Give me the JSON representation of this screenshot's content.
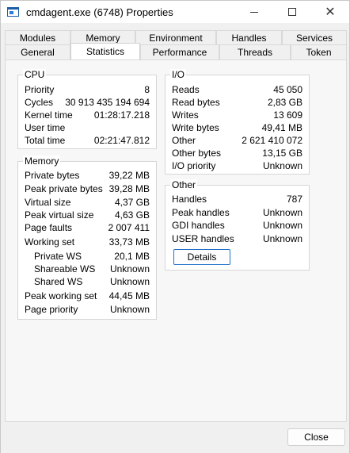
{
  "window": {
    "title": "cmdagent.exe (6748) Properties"
  },
  "tabs": {
    "row1": [
      "Modules",
      "Memory",
      "Environment",
      "Handles",
      "Services"
    ],
    "row2": [
      "General",
      "Statistics",
      "Performance",
      "Threads",
      "Token"
    ],
    "active": "Statistics"
  },
  "cpu": {
    "title": "CPU",
    "rows": [
      {
        "label": "Priority",
        "value": "8"
      },
      {
        "label": "Cycles",
        "value": "30 913 435 194 694"
      },
      {
        "label": "Kernel time",
        "value": "01:28:17.218"
      },
      {
        "label": "User time",
        "value": ""
      },
      {
        "label": "Total time",
        "value": "02:21:47.812"
      }
    ]
  },
  "memory": {
    "title": "Memory",
    "rows": [
      {
        "label": "Private bytes",
        "value": "39,22 MB"
      },
      {
        "label": "Peak private bytes",
        "value": "39,28 MB"
      },
      {
        "label": "Virtual size",
        "value": "4,37 GB"
      },
      {
        "label": "Peak virtual size",
        "value": "4,63 GB"
      },
      {
        "label": "Page faults",
        "value": "2 007 411"
      },
      {
        "label": "Working set",
        "value": "33,73 MB"
      },
      {
        "label": "Private WS",
        "value": "20,1 MB"
      },
      {
        "label": "Shareable WS",
        "value": "Unknown"
      },
      {
        "label": "Shared WS",
        "value": "Unknown"
      },
      {
        "label": "Peak working set",
        "value": "44,45 MB"
      },
      {
        "label": "Page priority",
        "value": "Unknown"
      }
    ]
  },
  "io": {
    "title": "I/O",
    "rows": [
      {
        "label": "Reads",
        "value": "45 050"
      },
      {
        "label": "Read bytes",
        "value": "2,83 GB"
      },
      {
        "label": "Writes",
        "value": "13 609"
      },
      {
        "label": "Write bytes",
        "value": "49,41 MB"
      },
      {
        "label": "Other",
        "value": "2 621 410 072"
      },
      {
        "label": "Other bytes",
        "value": "13,15 GB"
      },
      {
        "label": "I/O priority",
        "value": "Unknown"
      }
    ]
  },
  "other": {
    "title": "Other",
    "rows": [
      {
        "label": "Handles",
        "value": "787"
      },
      {
        "label": "Peak handles",
        "value": "Unknown"
      },
      {
        "label": "GDI handles",
        "value": "Unknown"
      },
      {
        "label": "USER handles",
        "value": "Unknown"
      }
    ],
    "details_label": "Details"
  },
  "footer": {
    "close_label": "Close"
  },
  "icons": {
    "app": "window-app-icon",
    "minimize": "minimize-icon",
    "maximize": "maximize-icon",
    "close": "close-icon"
  }
}
